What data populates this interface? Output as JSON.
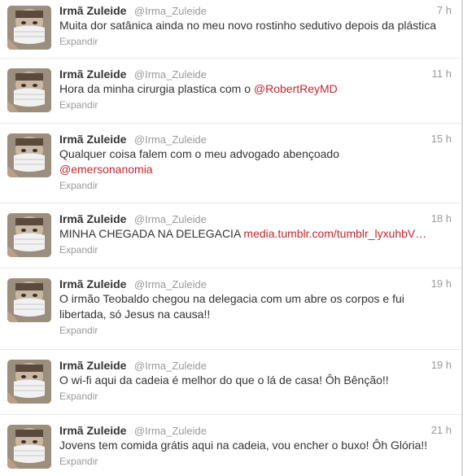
{
  "tweets": [
    {
      "name": "Irmã Zuleide",
      "handle": "@Irma_Zuleide",
      "time": "7 h",
      "text": "Muita dor satânica ainda no meu novo rostinho sedutivo depois da plástica",
      "line2": "",
      "link": "",
      "expand": "Expandir"
    },
    {
      "name": "Irmã Zuleide",
      "handle": "@Irma_Zuleide",
      "time": "11 h",
      "text": "Hora da minha cirurgia plastica com o ",
      "line2": "",
      "link": "@RobertReyMD",
      "expand": "Expandir"
    },
    {
      "name": "Irmã Zuleide",
      "handle": "@Irma_Zuleide",
      "time": "15 h",
      "text": "Qualquer coisa falem com o meu advogado abençoado",
      "line2": "",
      "link": "@emersonanomia",
      "expand": "Expandir"
    },
    {
      "name": "Irmã Zuleide",
      "handle": "@Irma_Zuleide",
      "time": "18 h",
      "text": "MINHA CHEGADA NA DELEGACIA ",
      "line2": "",
      "link": "media.tumblr.com/tumblr_lyxuhbV…",
      "expand": "Expandir"
    },
    {
      "name": "Irmã Zuleide",
      "handle": "@Irma_Zuleide",
      "time": "19 h",
      "text": "O irmão Teobaldo chegou na delegacia com um abre os corpos e fui",
      "line2": "libertada, só Jesus na causa!!",
      "link": "",
      "expand": "Expandir"
    },
    {
      "name": "Irmã Zuleide",
      "handle": "@Irma_Zuleide",
      "time": "19 h",
      "text": "O wi-fi aqui da cadeia é melhor do que o lá de casa! Ôh Bênção!!",
      "line2": "",
      "link": "",
      "expand": "Expandir"
    },
    {
      "name": "Irmã Zuleide",
      "handle": "@Irma_Zuleide",
      "time": "21 h",
      "text": "Jovens tem comida grátis aqui na cadeia, vou encher o buxo! Ôh Glória!!",
      "line2": "",
      "link": "",
      "expand": "Expandir"
    }
  ],
  "colors": {
    "link": "#c0262d",
    "name": "#333333",
    "meta": "#999999",
    "divider": "#e8e8e8"
  },
  "icons": {
    "avatar": "masked-face-avatar"
  }
}
